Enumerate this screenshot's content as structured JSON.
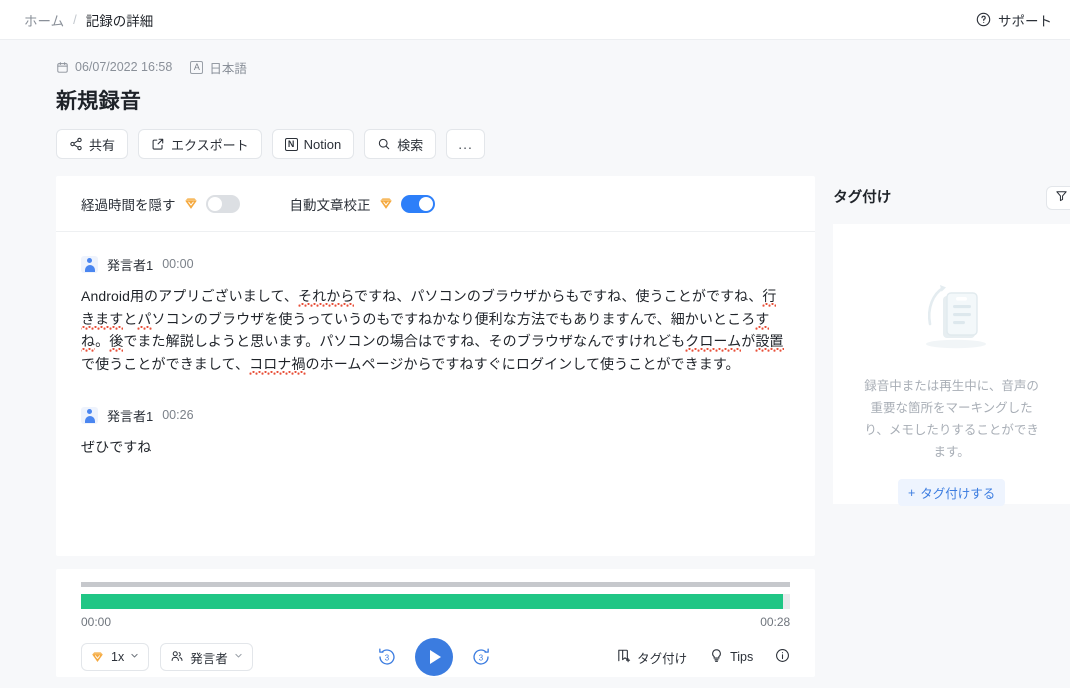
{
  "topbar": {
    "breadcrumb": {
      "home": "ホーム",
      "separator": "/",
      "current": "記録の詳細"
    },
    "support_label": "サポート",
    "support_icon": "question-circle-icon"
  },
  "header": {
    "date": "06/07/2022 16:58",
    "date_icon": "calendar-icon",
    "language": "日本語",
    "language_badge": "A",
    "title": "新規録音",
    "actions": [
      {
        "label": "共有",
        "icon": "share-icon"
      },
      {
        "label": "エクスポート",
        "icon": "export-icon"
      },
      {
        "label": "Notion",
        "icon": "notion-icon"
      },
      {
        "label": "検索",
        "icon": "search-icon"
      },
      {
        "label": "...",
        "icon": "more-icon"
      }
    ]
  },
  "options": [
    {
      "label": "経過時間を隠す",
      "badge": "vip-diamond-icon",
      "toggle_on": false
    },
    {
      "label": "自動文章校正",
      "badge": "vip-diamond-icon",
      "toggle_on": true
    }
  ],
  "transcript": {
    "segments": [
      {
        "speaker": "発言者1",
        "time": "00:00",
        "parts": [
          {
            "t": "Android用のアプリございまして、",
            "sq": false
          },
          {
            "t": "それから",
            "sq": true
          },
          {
            "t": "ですね、パソコンのブラウザからもですね、使うことがですね、",
            "sq": false
          },
          {
            "t": "行きます",
            "sq": true
          },
          {
            "t": "と",
            "sq": false
          },
          {
            "t": "パ",
            "sq": true
          },
          {
            "t": "ソコンのブラウザを使うっていうのもですねかなり便利な方法でもありますんで、細かいところ",
            "sq": false
          },
          {
            "t": "すね",
            "sq": true
          },
          {
            "t": "。",
            "sq": false
          },
          {
            "t": "後",
            "sq": true
          },
          {
            "t": "でまた解説しようと思います。パソコンの場合はですね、そのブラウザなんですけれども",
            "sq": false
          },
          {
            "t": "クローム",
            "sq": true
          },
          {
            "t": "が",
            "sq": false
          },
          {
            "t": "設置",
            "sq": true
          },
          {
            "t": "で使うことができまして、",
            "sq": false
          },
          {
            "t": "コロナ禍",
            "sq": true
          },
          {
            "t": "のホームページからですねすぐにログインして使うことができます。",
            "sq": false
          }
        ]
      },
      {
        "speaker": "発言者1",
        "time": "00:26",
        "parts": [
          {
            "t": "ぜひですね",
            "sq": false
          }
        ]
      }
    ]
  },
  "player": {
    "current_time": "00:00",
    "total_time": "00:28",
    "progress_percent": 0,
    "wave_fill_percent": 99,
    "speed": "1x",
    "speed_badge": "vip-diamond-icon",
    "speaker_label": "発言者",
    "speaker_icon": "speakers-icon",
    "rewind_seconds": "3",
    "forward_seconds": "3",
    "play_icon": "play-icon",
    "right_items": [
      {
        "label": "タグ付け",
        "icon": "tag-add-icon"
      },
      {
        "label": "Tips",
        "icon": "bulb-icon"
      },
      {
        "label": "",
        "icon": "info-icon"
      }
    ]
  },
  "sidebar": {
    "title": "タグ付け",
    "filter_icon": "filter-icon",
    "empty_illustration": "document-illustration",
    "empty_text": "録音中または再生中に、音声の重要な箇所をマーキングしたり、メモしたりすることができます。",
    "add_tag_label": "タグ付けする",
    "add_tag_icon": "plus-icon"
  },
  "colors": {
    "accent_blue": "#3b7ce0",
    "toggle_on": "#2d7ff9",
    "wave_green": "#20c685",
    "vip_orange": "#f0a33c",
    "page_bg": "#f7f8fa"
  }
}
